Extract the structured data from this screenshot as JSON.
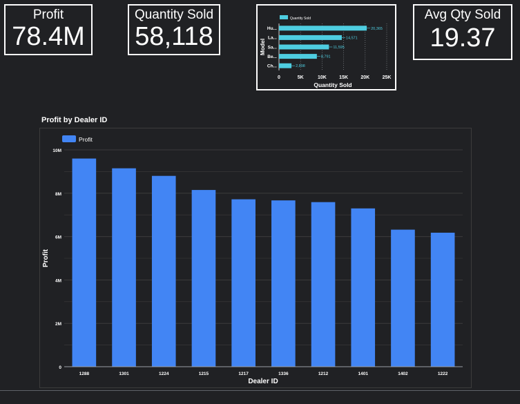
{
  "kpis": {
    "profit": {
      "label": "Profit",
      "value": "78.4M"
    },
    "quantity": {
      "label": "Quantity Sold",
      "value": "58,118"
    },
    "avg": {
      "label": "Avg Qty Sold",
      "value": "19.37"
    }
  },
  "colors": {
    "main_bar": "#4285f4",
    "mini_bar": "#4ecde0",
    "background": "#202124",
    "grid": "#3c3c3c",
    "text": "#ffffff"
  },
  "chart_data": [
    {
      "type": "bar",
      "orientation": "horizontal",
      "categories": [
        "Hu...",
        "La...",
        "Sa...",
        "Be...",
        "Ch..."
      ],
      "series": [
        {
          "name": "Quantity Sold",
          "values": [
            20365,
            14571,
            11595,
            8791,
            2898
          ]
        }
      ],
      "data_labels": [
        "20,365",
        "14,571",
        "11,595",
        "8,791",
        "2,898"
      ],
      "xlabel": "Quantity Sold",
      "ylabel": "Model",
      "xlim": [
        0,
        25000
      ],
      "xticks": [
        0,
        5000,
        10000,
        15000,
        20000,
        25000
      ],
      "xtick_labels": [
        "0",
        "5K",
        "10K",
        "15K",
        "20K",
        "25K"
      ],
      "grid": true,
      "legend": "top-left"
    },
    {
      "type": "bar",
      "title": "Profit by Dealer ID",
      "categories": [
        "1288",
        "1301",
        "1224",
        "1215",
        "1217",
        "1336",
        "1212",
        "1401",
        "1402",
        "1222"
      ],
      "series": [
        {
          "name": "Profit",
          "values": [
            9600000,
            9150000,
            8800000,
            8150000,
            7720000,
            7670000,
            7590000,
            7300000,
            6320000,
            6180000
          ]
        }
      ],
      "xlabel": "Dealer ID",
      "ylabel": "Profit",
      "ylim": [
        0,
        10000000
      ],
      "yticks": [
        0,
        2000000,
        4000000,
        6000000,
        8000000,
        10000000
      ],
      "ytick_labels": [
        "0",
        "2M",
        "4M",
        "6M",
        "8M",
        "10M"
      ],
      "grid": true,
      "legend": "top-left"
    }
  ]
}
